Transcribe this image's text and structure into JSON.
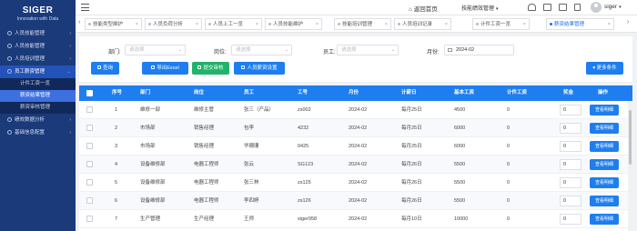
{
  "brand": {
    "title": "SIGER",
    "subtitle": "Innovation with Data"
  },
  "sidebar": {
    "items": [
      {
        "label": "人员技能管理"
      },
      {
        "label": "人员技能管理"
      },
      {
        "label": "人员培训管理"
      },
      {
        "label": "员工薪资管理"
      },
      {
        "label": "绩效数据分析"
      },
      {
        "label": "基础信息配置"
      }
    ],
    "submenu": [
      {
        "label": "计件工资一览"
      },
      {
        "label": "薪资结果管理"
      },
      {
        "label": "薪资审核管理"
      }
    ]
  },
  "topbar": {
    "home": "返回首页",
    "system": "技能绩效管理",
    "user": "siger"
  },
  "tabs": [
    {
      "label": "技能类型维护"
    },
    {
      "label": "人员负荷分析"
    },
    {
      "label": "人员上工一览"
    },
    {
      "label": "人员技能维护"
    },
    {
      "label": "技能培训管理"
    },
    {
      "label": "人员培训记录"
    },
    {
      "label": "计件工资一览"
    },
    {
      "label": "薪资结果管理"
    }
  ],
  "filters": {
    "dept_label": "部门:",
    "dept_placeholder": "请选择",
    "post_label": "岗位:",
    "post_placeholder": "请选择",
    "staff_label": "员工:",
    "staff_placeholder": "请选择",
    "month_label": "月份:",
    "month_value": "2024-02"
  },
  "buttons": {
    "search": "查询",
    "export": "导出Excel",
    "submit": "提交审核",
    "salary_setting": "人员薪资设置",
    "more": "更多条件"
  },
  "table": {
    "columns": [
      "序号",
      "部门",
      "岗位",
      "员工",
      "工号",
      "月份",
      "计薪日",
      "基本工资",
      "计件工资",
      "奖金",
      "操作"
    ],
    "view_label": "查看明细",
    "rows": [
      {
        "no": "1",
        "dept": "维修一部",
        "post": "维修主管",
        "staff": "张三（产品）",
        "code": "zs002",
        "month": "2024-02",
        "payday": "每月25日",
        "base": "4500",
        "piece": "0"
      },
      {
        "no": "2",
        "dept": "市场部",
        "post": "销售经理",
        "staff": "包李",
        "code": "4232",
        "month": "2024-02",
        "payday": "每月25日",
        "base": "6000",
        "piece": "0"
      },
      {
        "no": "3",
        "dept": "市场部",
        "post": "销售经理",
        "staff": "华珊珊",
        "code": "0425",
        "month": "2024-02",
        "payday": "每月25日",
        "base": "6000",
        "piece": "0"
      },
      {
        "no": "4",
        "dept": "设备维修部",
        "post": "电器工程师",
        "staff": "张云",
        "code": "SG123",
        "month": "2024-02",
        "payday": "每月26日",
        "base": "5500",
        "piece": "0"
      },
      {
        "no": "5",
        "dept": "设备维修部",
        "post": "电器工程师",
        "staff": "张三林",
        "code": "zs125",
        "month": "2024-02",
        "payday": "每月26日",
        "base": "5500",
        "piece": "0"
      },
      {
        "no": "6",
        "dept": "设备维修部",
        "post": "电器工程师",
        "staff": "李四婷",
        "code": "zs126",
        "month": "2024-02",
        "payday": "每月26日",
        "base": "5500",
        "piece": "0"
      },
      {
        "no": "7",
        "dept": "生产管理",
        "post": "生产经理",
        "staff": "王师",
        "code": "siger958",
        "month": "2024-02",
        "payday": "每月10日",
        "base": "10000",
        "piece": "0"
      }
    ]
  }
}
